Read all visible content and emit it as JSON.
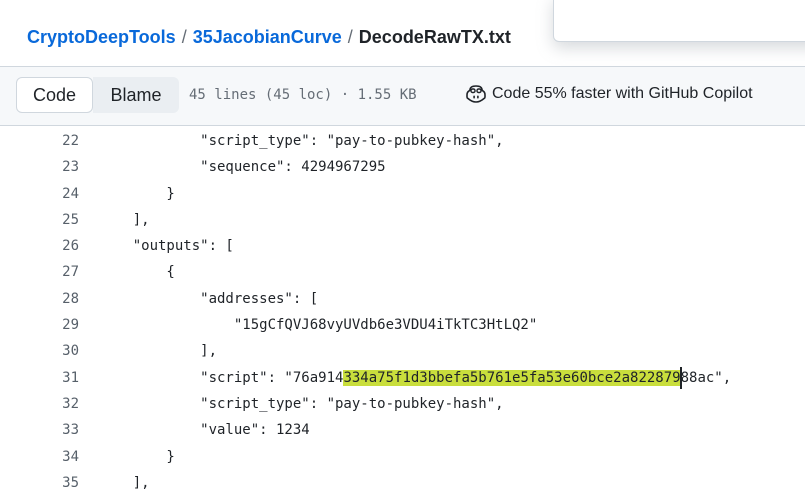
{
  "breadcrumb": {
    "owner": "CryptoDeepTools",
    "repo": "35JacobianCurve",
    "file": "DecodeRawTX.txt",
    "separator": "/"
  },
  "toolbar": {
    "code_tab": "Code",
    "blame_tab": "Blame",
    "file_info": "45 lines (45 loc) · 1.55 KB",
    "copilot_text": "Code 55% faster with GitHub Copilot",
    "copilot_icon": "copilot-icon"
  },
  "code_lines": [
    {
      "n": "22",
      "text": "            \"script_type\": \"pay-to-pubkey-hash\","
    },
    {
      "n": "23",
      "text": "            \"sequence\": 4294967295"
    },
    {
      "n": "24",
      "text": "        }"
    },
    {
      "n": "25",
      "text": "    ],"
    },
    {
      "n": "26",
      "text": "    \"outputs\": ["
    },
    {
      "n": "27",
      "text": "        {"
    },
    {
      "n": "28",
      "text": "            \"addresses\": ["
    },
    {
      "n": "29",
      "text": "                \"15gCfQVJ68vyUVdb6e3VDU4iTkTC3HtLQ2\""
    },
    {
      "n": "30",
      "text": "            ],"
    },
    {
      "n": "31",
      "pre": "            \"script\": \"76a914",
      "highlight": "334a75f1d3bbefa5b761e5fa53e60bce2a822879",
      "post": "88ac\","
    },
    {
      "n": "32",
      "text": "            \"script_type\": \"pay-to-pubkey-hash\","
    },
    {
      "n": "33",
      "text": "            \"value\": 1234"
    },
    {
      "n": "34",
      "text": "        }"
    },
    {
      "n": "35",
      "text": "    ],"
    }
  ],
  "colors": {
    "link": "#0969da",
    "highlight": "#c9de3c"
  }
}
